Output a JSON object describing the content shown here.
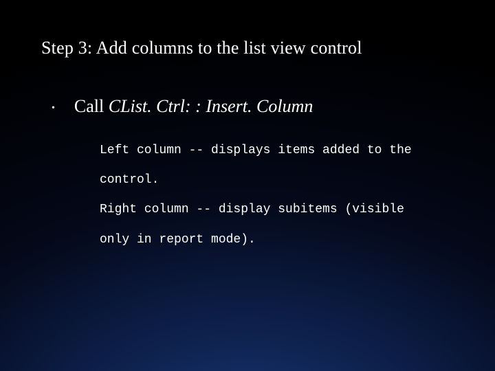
{
  "title": "Step 3:  Add columns to the list view control",
  "bullet": {
    "call_label": "Call ",
    "method": "CList. Ctrl: : Insert. Column"
  },
  "subtext": {
    "line1": "Left column -- displays items added to the control.",
    "line2": "Right column -- display subitems (visible only in report mode)."
  }
}
